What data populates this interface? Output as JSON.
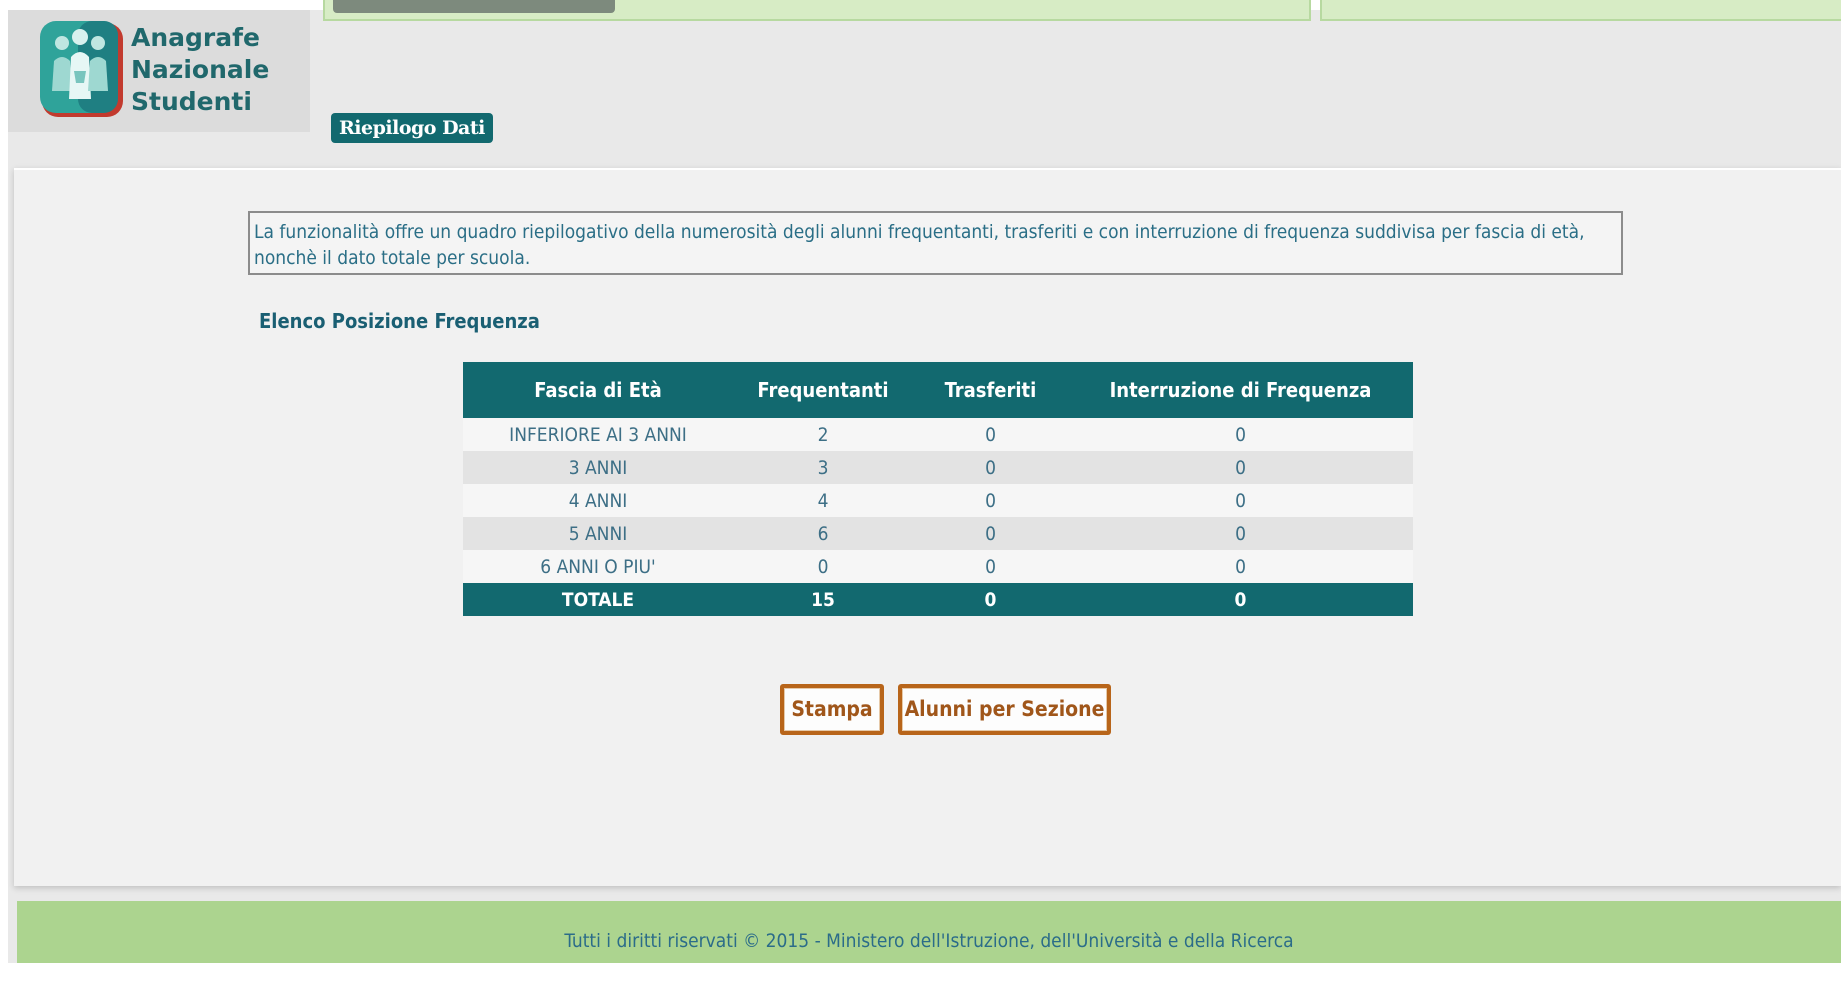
{
  "app": {
    "logo_lines": [
      "Anagrafe",
      "Nazionale",
      "Studenti"
    ]
  },
  "page": {
    "title": "Riepilogo Dati",
    "description_line1": "La funzionalità offre un quadro riepilogativo della numerosità degli alunni frequentanti, trasferiti e con interruzione di frequenza suddivisa per fascia di età,",
    "description_line2": "nonchè il dato totale per scuola.",
    "section_title": "Elenco Posizione Frequenza"
  },
  "table": {
    "headers": [
      "Fascia di Età",
      "Frequentanti",
      "Trasferiti",
      "Interruzione di Frequenza"
    ],
    "rows": [
      [
        "INFERIORE AI 3 ANNI",
        "2",
        "0",
        "0"
      ],
      [
        "3 ANNI",
        "3",
        "0",
        "0"
      ],
      [
        "4 ANNI",
        "4",
        "0",
        "0"
      ],
      [
        "5 ANNI",
        "6",
        "0",
        "0"
      ],
      [
        "6 ANNI O PIU'",
        "0",
        "0",
        "0"
      ]
    ],
    "total": [
      "TOTALE",
      "15",
      "0",
      "0"
    ]
  },
  "buttons": {
    "print_label": "Stampa",
    "by_section_label": "Alunni per Sezione"
  },
  "footer": {
    "text": "Tutti i diritti riservati © 2015 -  Ministero dell'Istruzione, dell'Università e della Ricerca"
  },
  "colors": {
    "primary_teal": "#12696f",
    "button_border": "#b8651a",
    "footer_green": "#acd48f"
  },
  "icons": {
    "logo": "students-group-logo-icon"
  }
}
